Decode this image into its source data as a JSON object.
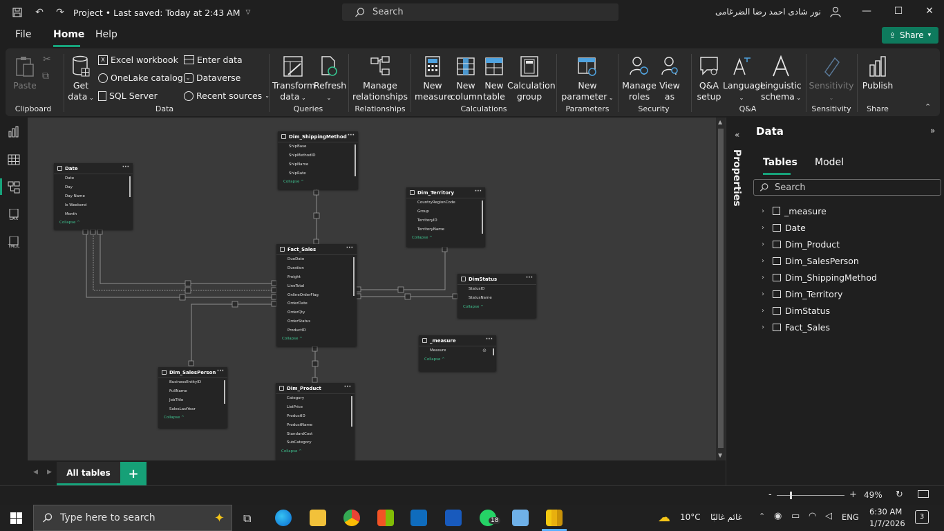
{
  "title_bar": {
    "project_title": "Project • Last saved: Today at 2:43 AM",
    "search_placeholder": "Search",
    "user_name": "نور شادى احمد رضا الضرغامى"
  },
  "menu": {
    "file": "File",
    "home": "Home",
    "help": "Help",
    "share": "Share"
  },
  "ribbon": {
    "clipboard": {
      "paste": "Paste",
      "label": "Clipboard"
    },
    "data": {
      "get_data_1": "Get",
      "get_data_2": "data",
      "excel": "Excel workbook",
      "onelake": "OneLake catalog",
      "sql": "SQL Server",
      "enter_data": "Enter data",
      "dataverse": "Dataverse",
      "recent": "Recent sources",
      "label": "Data"
    },
    "queries": {
      "transform_1": "Transform",
      "transform_2": "data",
      "refresh": "Refresh",
      "label": "Queries"
    },
    "relationships": {
      "manage_1": "Manage",
      "manage_2": "relationships",
      "label": "Relationships"
    },
    "calculations": {
      "new_measure_1": "New",
      "new_measure_2": "measure",
      "new_column_1": "New",
      "new_column_2": "column",
      "new_table_1": "New",
      "new_table_2": "table",
      "calc_group_1": "Calculation",
      "calc_group_2": "group",
      "label": "Calculations"
    },
    "parameters": {
      "new_param_1": "New",
      "new_param_2": "parameter",
      "label": "Parameters"
    },
    "security": {
      "manage_roles_1": "Manage",
      "manage_roles_2": "roles",
      "view_as_1": "View",
      "view_as_2": "as",
      "label": "Security"
    },
    "qa": {
      "qa_setup_1": "Q&A",
      "qa_setup_2": "setup",
      "language": "Language",
      "linguistic_1": "Linguistic",
      "linguistic_2": "schema",
      "label": "Q&A"
    },
    "sensitivity": {
      "sensitivity": "Sensitivity",
      "label": "Sensitivity"
    },
    "share": {
      "publish": "Publish",
      "label": "Share"
    }
  },
  "rail": {
    "dax": "DAX",
    "tmdl": "TMDL"
  },
  "tables": {
    "date": {
      "name": "Date",
      "fields": [
        "Date",
        "Day",
        "Day Name",
        "Is Weekend",
        "Month"
      ]
    },
    "shipping": {
      "name": "Dim_ShippingMethod",
      "fields": [
        "ShipBase",
        "ShipMethodID",
        "ShipName",
        "ShipRate"
      ]
    },
    "territory": {
      "name": "Dim_Territory",
      "fields": [
        "CountryRegionCode",
        "Group",
        "TerritoryID",
        "TerritoryName"
      ]
    },
    "fact": {
      "name": "Fact_Sales",
      "fields": [
        "DueDate",
        "Duration",
        "Freight",
        "LineTotal",
        "OnlineOrderFlag",
        "OrderDate",
        "OrderQty",
        "OrderStatus",
        "ProductID"
      ]
    },
    "status": {
      "name": "DimStatus",
      "fields": [
        "StatusID",
        "StatusName"
      ]
    },
    "measure": {
      "name": "_measure",
      "fields": [
        "Measure"
      ]
    },
    "salesperson": {
      "name": "Dim_SalesPerson",
      "fields": [
        "BusinessEntityID",
        "FullName",
        "JobTitle",
        "SalesLastYear"
      ]
    },
    "product": {
      "name": "Dim_Product",
      "fields": [
        "Category",
        "ListPrice",
        "ProductID",
        "ProductName",
        "StandardCost",
        "SubCategory"
      ]
    },
    "collapse": "Collapse ^"
  },
  "bottom_tabs": {
    "all_tables": "All tables",
    "add": "+"
  },
  "properties": {
    "label": "Properties"
  },
  "data_pane": {
    "title": "Data",
    "tab_tables": "Tables",
    "tab_model": "Model",
    "search_placeholder": "Search",
    "items": [
      "_measure",
      "Date",
      "Dim_Product",
      "Dim_SalesPerson",
      "Dim_ShippingMethod",
      "Dim_Territory",
      "DimStatus",
      "Fact_Sales"
    ]
  },
  "status_bar": {
    "zoom": "49%",
    "minus": "-",
    "plus": "+"
  },
  "taskbar": {
    "search_placeholder": "Type here to search",
    "weather_temp": "10°C",
    "weather_desc": "غائم غالبًا",
    "lang": "ENG",
    "time": "6:30 AM",
    "date": "1/7/2026",
    "notif_count": "3",
    "whatsapp_badge": "18"
  },
  "colors": {
    "accent": "#17a37b",
    "canvas": "#3a3a3a",
    "card": "#242424"
  }
}
